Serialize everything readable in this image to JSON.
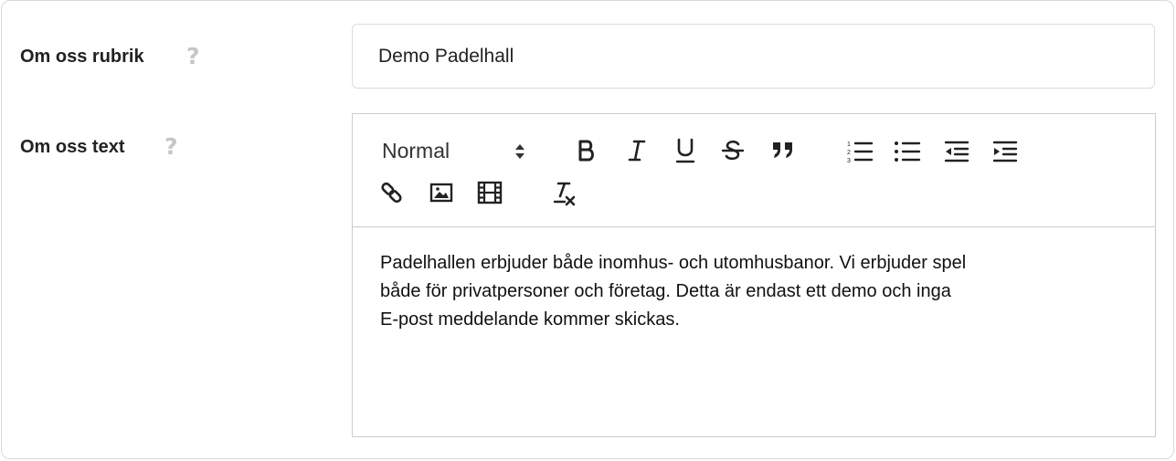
{
  "fields": [
    {
      "label": "Om oss rubrik",
      "help": "?",
      "value": "Demo Padelhall"
    },
    {
      "label": "Om oss text",
      "help": "?"
    }
  ],
  "editor": {
    "header_select": "Normal",
    "toolbar_icons": [
      "bold-icon",
      "italic-icon",
      "underline-icon",
      "strike-icon",
      "blockquote-icon",
      "ordered-list-icon",
      "bullet-list-icon",
      "outdent-icon",
      "indent-icon",
      "link-icon",
      "image-icon",
      "video-icon",
      "clear-format-icon"
    ],
    "content_lines": [
      "Padelhallen erbjuder både inomhus- och utomhusbanor. Vi erbjuder spel",
      "både för privatpersoner och företag. Detta är endast ett demo och inga",
      "E-post meddelande kommer skickas."
    ]
  },
  "colors": {
    "help_icon": "#c6c6c6",
    "border": "#cccccc",
    "text": "#222222"
  }
}
